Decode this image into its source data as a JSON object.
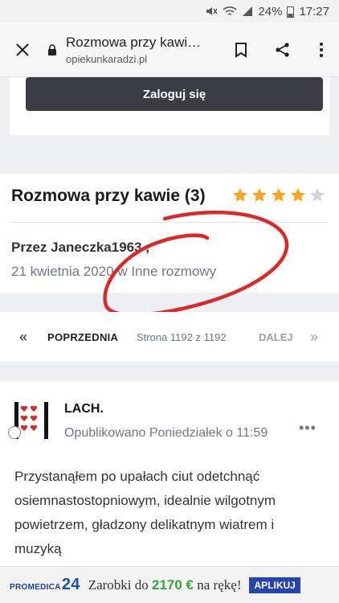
{
  "status": {
    "battery": "24%",
    "time": "17:27"
  },
  "browser": {
    "tab_title": "Rozmowa przy kawie...",
    "domain": "opiekunkaradzi.pl"
  },
  "login": {
    "button_label": "Zaloguj się"
  },
  "topic": {
    "title": "Rozmowa przy kawie (3)",
    "rating": 4,
    "rating_max": 5,
    "author": "Przez Janeczka1963 ,",
    "date": "21 kwietnia 2020",
    "in_word": " w ",
    "category": "Inne rozmowy"
  },
  "pager": {
    "prev_arrow": "«",
    "prev_label": "POPRZEDNIA",
    "page_info": "Strona 1192 z 1192",
    "next_label": "DALEJ",
    "next_arrow": "»"
  },
  "post": {
    "username": "LACH.",
    "posted": "Opublikowano Poniedziałek o 11:59",
    "more": "•••",
    "body": "Przystanąłem po upałach ciut odetchnąć osiemnastostopniowym, idealnie wilgotnym powietrzem, gładzony delikatnym wiatrem i muzyką"
  },
  "ad": {
    "logo": "PROMEDICA",
    "logo_num": "24",
    "text_pre": "Zarobki do ",
    "amount": "2170 €",
    "text_post": " na rękę!",
    "cta": "APLIKUJ"
  },
  "colors": {
    "star": "#f5a623",
    "accent_dark": "#3a3d44",
    "scribble": "#d92a2a"
  }
}
